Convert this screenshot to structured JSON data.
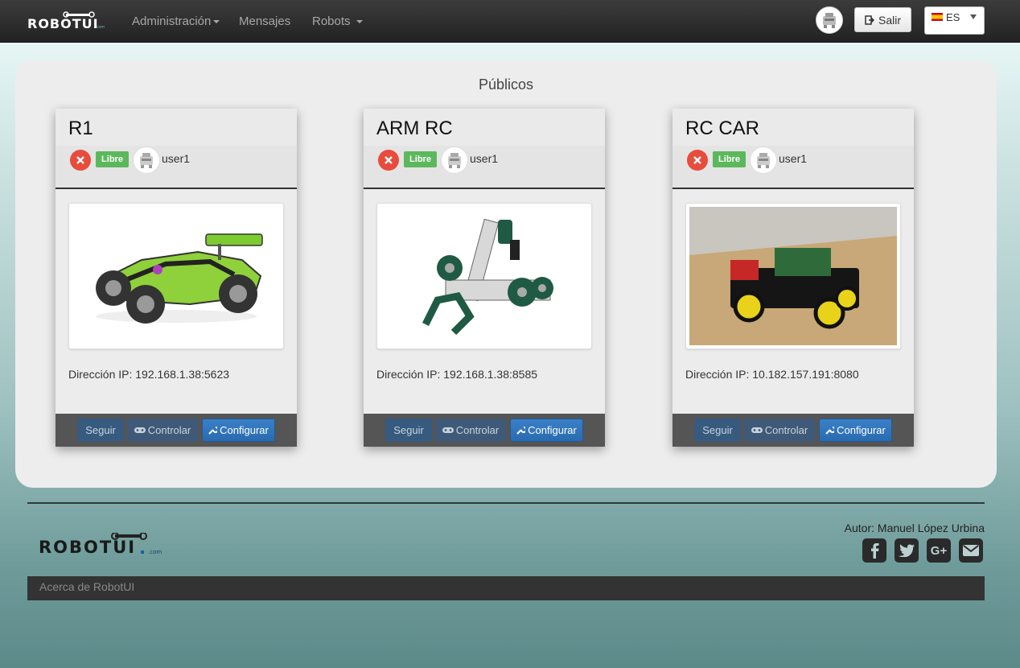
{
  "nav": {
    "brand": "ROBOTUI",
    "brand_suffix": ".com",
    "items": [
      {
        "label": "Administración"
      },
      {
        "label": "Mensajes"
      },
      {
        "label": "Robots"
      }
    ],
    "logout_label": "Salir",
    "language": "ES"
  },
  "main": {
    "section_title": "Públicos",
    "robots": [
      {
        "name": "R1",
        "status": "Libre",
        "owner": "user1",
        "ip_label": "Dirección IP:",
        "ip": "192.168.1.38:5623"
      },
      {
        "name": "ARM RC",
        "status": "Libre",
        "owner": "user1",
        "ip_label": "Dirección IP:",
        "ip": "192.168.1.38:8585"
      },
      {
        "name": "RC CAR",
        "status": "Libre",
        "owner": "user1",
        "ip_label": "Dirección IP:",
        "ip": "10.182.157.191:8080"
      }
    ],
    "actions": {
      "follow": "Seguir",
      "control": "Controlar",
      "configure": "Configurar"
    }
  },
  "footer": {
    "author": "Autor: Manuel López Urbina",
    "about": "Acerca de RobotUI",
    "social": [
      "facebook-icon",
      "twitter-icon",
      "google-plus-icon",
      "email-icon"
    ]
  },
  "colors": {
    "accent": "#2a6bb0",
    "badge_free": "#5cb85c",
    "status_error": "#e74c3c"
  }
}
